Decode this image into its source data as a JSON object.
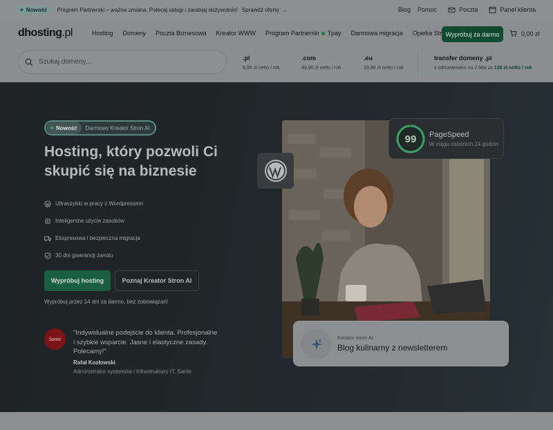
{
  "topbar": {
    "badge": "Nowość",
    "promo": "Program Partnerski – ważna zmiana. Polecaj usługi i zarabiaj dożywotnio!",
    "cta": "Sprawdź ofertę",
    "links": [
      "Blog",
      "Pomoc"
    ],
    "mail": "Poczta",
    "panel": "Panel klienta"
  },
  "nav": {
    "logo_main": "dhosting",
    "logo_tld": ".pl",
    "menu": [
      "Hosting",
      "Domeny",
      "Poczta Biznesowa",
      "Kreator WWW",
      "Program Partnerski",
      "Tpay",
      "Darmowa migracja",
      "Opieka Stron"
    ],
    "try_label": "Wypróbuj za darmo",
    "cart_value": "0,00 zł"
  },
  "search": {
    "placeholder": "Szukaj domeny...",
    "tlds": [
      {
        "name": ".pl",
        "price": "9,90 zł netto / rok"
      },
      {
        "name": ".com",
        "price": "49,90 zł netto / rok"
      },
      {
        "name": ".eu",
        "price": "19,90 zł netto / rok"
      }
    ],
    "transfer": {
      "name": "transfer domeny .pl",
      "prefix": "z odnowieniem na 2 lata za",
      "price": "139 zł netto / rok"
    }
  },
  "hero": {
    "pill_new": "Nowość",
    "pill_text": "Darmowy Kreator Stron AI",
    "headline": "Hosting, który pozwoli Ci skupić się na biznesie",
    "features": [
      {
        "icon": "wordpress-icon",
        "text": "Ultraszybki w pracy z Wordpressem"
      },
      {
        "icon": "chip-icon",
        "text": "Inteligentne użycie zasobów"
      },
      {
        "icon": "truck-icon",
        "text": "Ekspresowa i bezpieczna migracja"
      },
      {
        "icon": "shield-check-icon",
        "text": "30 dni gwarancji zwrotu"
      }
    ],
    "primary_btn": "Wypróbuj hosting",
    "secondary_btn": "Poznaj Kreator Stron AI",
    "trial": "Wypróbuj przez 14 dni za darmo, bez zobowiązań!",
    "logo_text": "Sante",
    "quote": "\"Indywidualne podejście do klienta. Profesjonalne i szybkie wsparcie. Jasne i elastyczne zasady. Polecamy!\"",
    "author": "Rafał Kozłowski",
    "role": "Administrator systemów i infrastruktury IT, Sante",
    "pagespeed_score": "99",
    "pagespeed_title": "PageSpeed",
    "pagespeed_sub": "W ciągu ostatnich 24 godzin",
    "ai_label": "Kreator stron AI",
    "ai_text": "Blog kulinarny z newsletterem"
  },
  "colors": {
    "brand_green": "#114a33",
    "accent_green": "#3ca36f"
  }
}
